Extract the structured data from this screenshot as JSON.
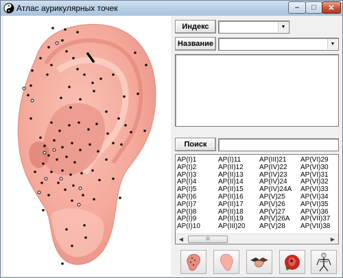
{
  "window": {
    "title": "Атлас аурикулярных точек",
    "controls": {
      "minimize": "–",
      "maximize": "□",
      "close": "✕"
    }
  },
  "search_panel": {
    "index_label": "Индекс",
    "index_value": "",
    "name_label": "Название",
    "name_value": "",
    "description": "",
    "search_label": "Поиск",
    "search_value": ""
  },
  "point_list": {
    "columns": [
      [
        "AP(I)1",
        "AP(I)2",
        "AP(I)3",
        "AP(I)4",
        "AP(I)5",
        "AP(I)6",
        "AP(I)7",
        "AP(I)8",
        "AP(I)9",
        "AP(I)10"
      ],
      [
        "AP(I)11",
        "AP(II)12",
        "AP(II)13",
        "AP(II)14",
        "AP(II)15",
        "AP(II)16",
        "AP(II)17",
        "AP(II)18",
        "AP(II)19",
        "AP(III)20"
      ],
      [
        "AP(III)21",
        "AP(IV)22",
        "AP(IV)23",
        "AP(IV)24",
        "AP(IV)24A",
        "AP(V)25",
        "AP(V)26",
        "AP(V)27",
        "AP(V)26A",
        "AP(V)28"
      ],
      [
        "AP(VI)29",
        "AP(VI)30",
        "AP(VI)31",
        "AP(VI)32",
        "AP(VI)33",
        "AP(VI)34",
        "AP(VI)35",
        "AP(VI)36",
        "AP(VII)37",
        "AP(VII)38"
      ]
    ],
    "scroll_thumb": "III"
  },
  "toolbar": {
    "buttons": [
      "ear-front-icon",
      "ear-back-icon",
      "handshake-icon",
      "red-ear-icon",
      "skeleton-icon"
    ]
  },
  "colors": {
    "ear_skin": "#f4a89a",
    "ear_shadow": "#e5847a",
    "point": "#111111"
  }
}
